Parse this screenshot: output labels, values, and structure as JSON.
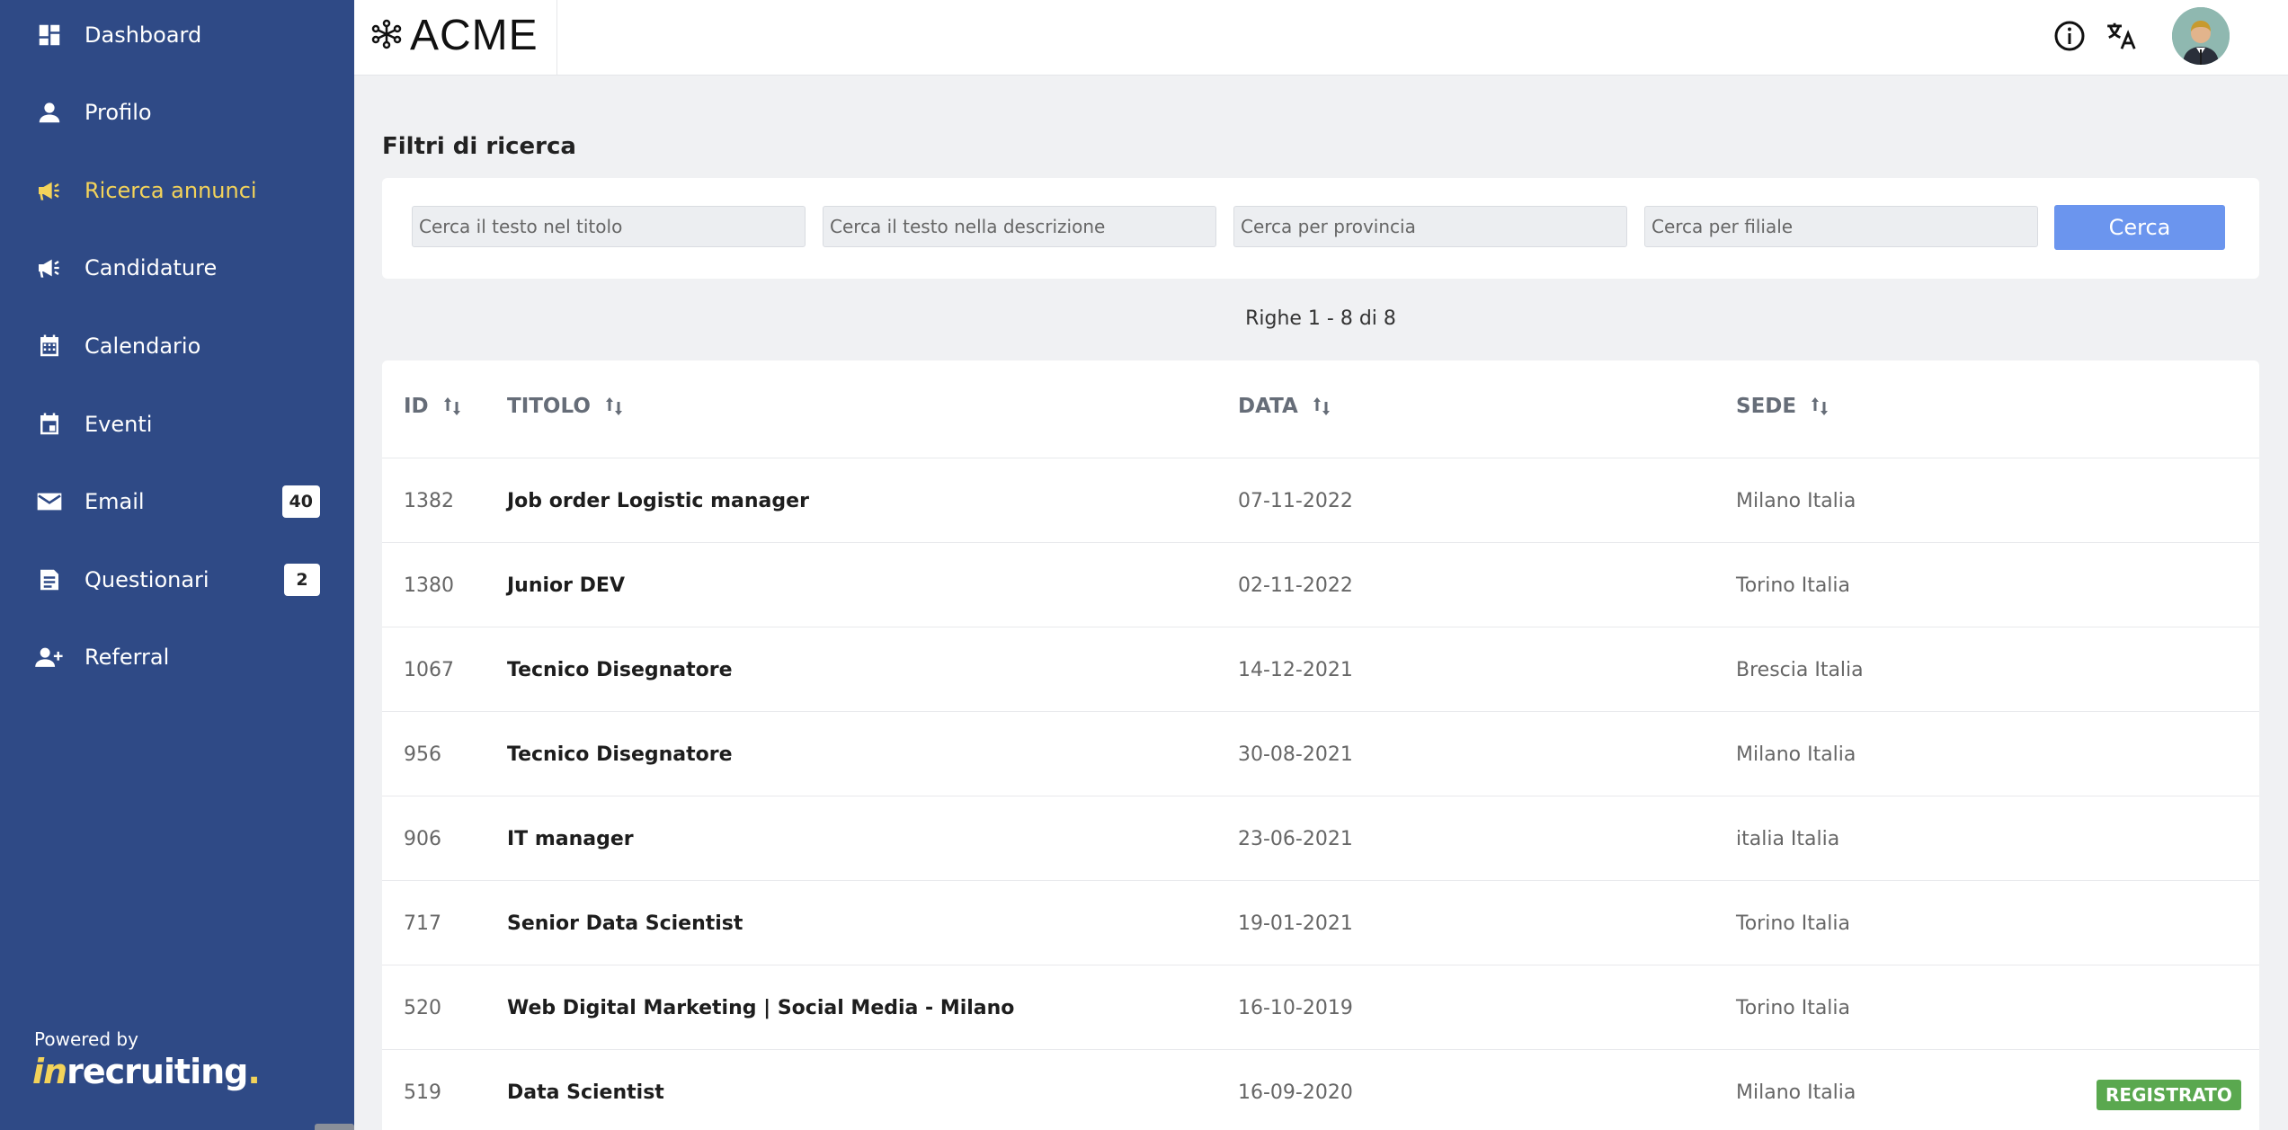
{
  "sidebar": {
    "items": [
      {
        "label": "Dashboard",
        "icon": "dashboard-icon"
      },
      {
        "label": "Profilo",
        "icon": "person-icon"
      },
      {
        "label": "Ricerca annunci",
        "icon": "megaphone-icon",
        "active": true
      },
      {
        "label": "Candidature",
        "icon": "megaphone-icon"
      },
      {
        "label": "Calendario",
        "icon": "calendar-icon"
      },
      {
        "label": "Eventi",
        "icon": "event-icon"
      },
      {
        "label": "Email",
        "icon": "mail-icon",
        "badge": "40"
      },
      {
        "label": "Questionari",
        "icon": "document-icon",
        "badge": "2"
      },
      {
        "label": "Referral",
        "icon": "add-person-icon"
      }
    ],
    "powered_by": "Powered by",
    "brand_prefix": "in",
    "brand_main": "recruiting",
    "brand_dot": "."
  },
  "header": {
    "logo_text": "ACME",
    "icons": [
      "info-icon",
      "translate-icon",
      "avatar"
    ]
  },
  "filters": {
    "title": "Filtri di ricerca",
    "title_placeholder": "Cerca il testo nel titolo",
    "description_placeholder": "Cerca il testo nella descrizione",
    "province_placeholder": "Cerca per provincia",
    "branch_placeholder": "Cerca per filiale",
    "search_label": "Cerca"
  },
  "rows_info": "Righe 1 - 8 di 8",
  "table": {
    "columns": [
      "ID",
      "TITOLO",
      "DATA",
      "SEDE"
    ],
    "rows": [
      {
        "id": "1382",
        "title": "Job order Logistic manager",
        "date": "07-11-2022",
        "location": "Milano Italia",
        "status": ""
      },
      {
        "id": "1380",
        "title": "Junior DEV",
        "date": "02-11-2022",
        "location": "Torino Italia",
        "status": ""
      },
      {
        "id": "1067",
        "title": "Tecnico Disegnatore",
        "date": "14-12-2021",
        "location": "Brescia Italia",
        "status": ""
      },
      {
        "id": "956",
        "title": "Tecnico Disegnatore",
        "date": "30-08-2021",
        "location": "Milano Italia",
        "status": ""
      },
      {
        "id": "906",
        "title": "IT manager",
        "date": "23-06-2021",
        "location": "italia Italia",
        "status": ""
      },
      {
        "id": "717",
        "title": "Senior Data Scientist",
        "date": "19-01-2021",
        "location": "Torino Italia",
        "status": ""
      },
      {
        "id": "520",
        "title": "Web Digital Marketing | Social Media - Milano",
        "date": "16-10-2019",
        "location": "Torino Italia",
        "status": ""
      },
      {
        "id": "519",
        "title": "Data Scientist",
        "date": "16-09-2020",
        "location": "Milano Italia",
        "status": "REGISTRATO"
      }
    ]
  },
  "colors": {
    "sidebar_bg": "#2f4a86",
    "active_item": "#f3d35a",
    "primary_button": "#6b95ee",
    "registered_badge": "#5aa84f"
  }
}
